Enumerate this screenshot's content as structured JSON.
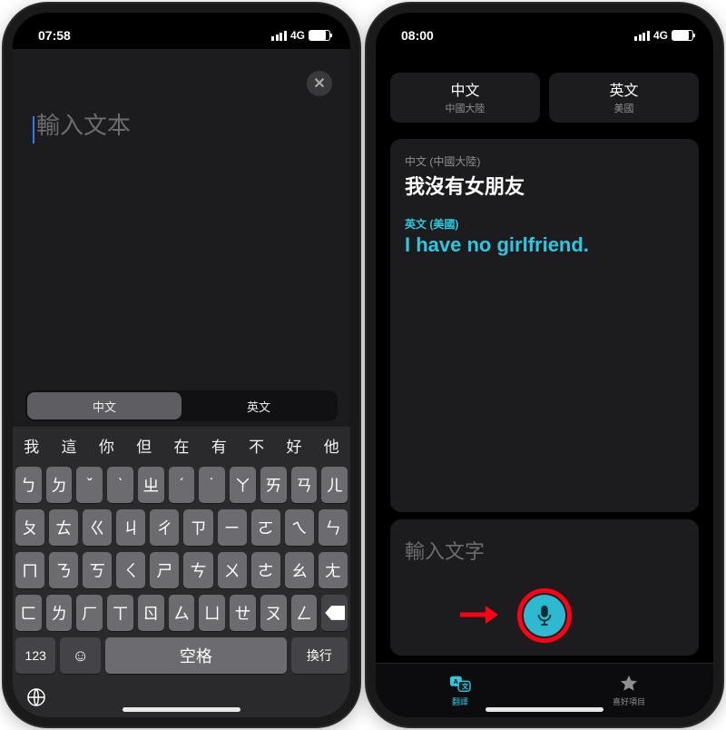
{
  "left": {
    "status": {
      "time": "07:58",
      "network": "4G"
    },
    "close_label": "✕",
    "input_placeholder": "輸入文本",
    "lang_segment": {
      "option_a": "中文",
      "option_b": "英文"
    },
    "predictions": [
      "我",
      "這",
      "你",
      "但",
      "在",
      "有",
      "不",
      "好",
      "他"
    ],
    "keyboard": {
      "row1": [
        "ㄅ",
        "ㄉ",
        "ˇ",
        "ˋ",
        "ㄓ",
        "ˊ",
        "˙",
        "ㄚ",
        "ㄞ",
        "ㄢ",
        "ㄦ"
      ],
      "row2": [
        "ㄆ",
        "ㄊ",
        "ㄍ",
        "ㄐ",
        "ㄔ",
        "ㄗ",
        "ㄧ",
        "ㄛ",
        "ㄟ",
        "ㄣ"
      ],
      "row3": [
        "ㄇ",
        "ㄋ",
        "ㄎ",
        "ㄑ",
        "ㄕ",
        "ㄘ",
        "ㄨ",
        "ㄜ",
        "ㄠ",
        "ㄤ"
      ],
      "row4_keys": [
        "ㄈ",
        "ㄌ",
        "ㄏ",
        "ㄒ",
        "ㄖ",
        "ㄙ",
        "ㄩ",
        "ㄝ",
        "ㄡ",
        "ㄥ"
      ],
      "numbers_label": "123",
      "space_label": "空格",
      "return_label": "換行"
    }
  },
  "right": {
    "status": {
      "time": "08:00",
      "network": "4G"
    },
    "lang_left": {
      "title": "中文",
      "subtitle": "中國大陸"
    },
    "lang_right": {
      "title": "英文",
      "subtitle": "美國"
    },
    "source": {
      "lang_label": "中文 (中國大陸)",
      "text": "我沒有女朋友"
    },
    "target": {
      "lang_label": "英文 (美國)",
      "text": "I have no girlfriend."
    },
    "input_placeholder": "輸入文字",
    "tabs": {
      "translate": "翻譯",
      "favorites": "喜好項目"
    }
  }
}
